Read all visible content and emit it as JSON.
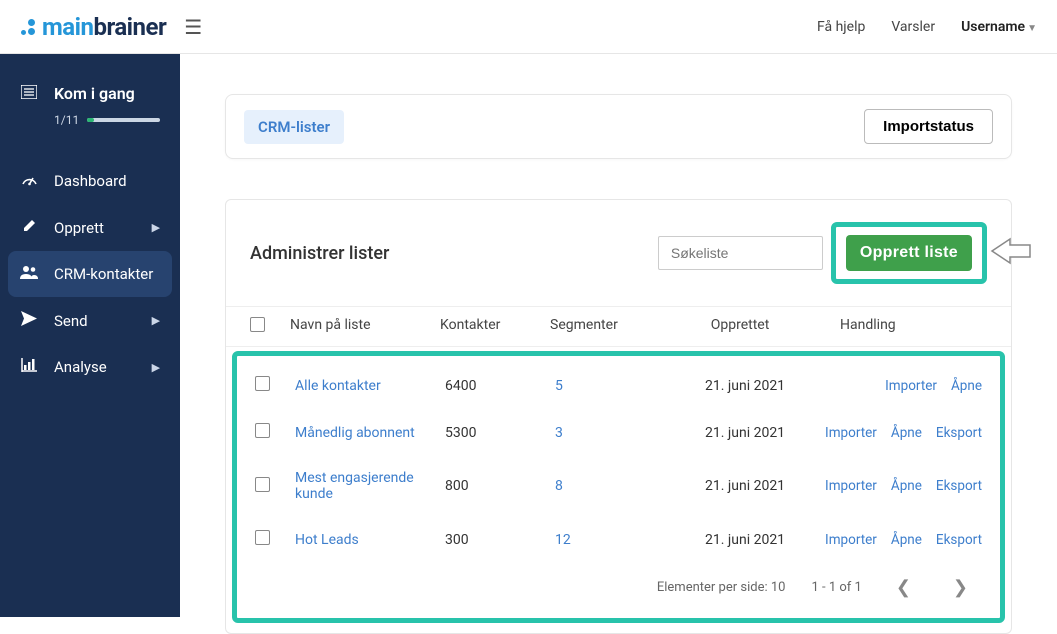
{
  "header": {
    "logo_main": "main",
    "logo_brain": "brainer",
    "help": "Få hjelp",
    "alerts": "Varsler",
    "username": "Username"
  },
  "sidebar": {
    "kom": {
      "title": "Kom i gang",
      "count": "1/11",
      "progress_pct": 9
    },
    "items": [
      {
        "icon": "gauge",
        "label": "Dashboard",
        "has_chevron": false
      },
      {
        "icon": "pencil",
        "label": "Opprett",
        "has_chevron": true
      },
      {
        "icon": "users",
        "label": "CRM-kontakter",
        "has_chevron": false,
        "active": true
      },
      {
        "icon": "paperplane",
        "label": "Send",
        "has_chevron": true
      },
      {
        "icon": "chart",
        "label": "Analyse",
        "has_chevron": true
      }
    ]
  },
  "top_card": {
    "crm_pill": "CRM-lister",
    "import_status": "Importstatus"
  },
  "table": {
    "title": "Administrer lister",
    "search_placeholder": "Søkeliste",
    "create_btn": "Opprett liste",
    "columns": {
      "name": "Navn på liste",
      "contacts": "Kontakter",
      "segments": "Segmenter",
      "created": "Opprettet",
      "action": "Handling"
    },
    "rows": [
      {
        "name": "Alle kontakter",
        "contacts": "6400",
        "segments": "5",
        "created": "21. juni 2021",
        "actions": [
          "Importer",
          "Åpne"
        ]
      },
      {
        "name": "Månedlig abonnent",
        "contacts": "5300",
        "segments": "3",
        "created": "21. juni 2021",
        "actions": [
          "Importer",
          "Åpne",
          "Eksport"
        ]
      },
      {
        "name": "Mest engasjerende kunde",
        "contacts": "800",
        "segments": "8",
        "created": "21. juni 2021",
        "actions": [
          "Importer",
          "Åpne",
          "Eksport"
        ]
      },
      {
        "name": "Hot Leads",
        "contacts": "300",
        "segments": "12",
        "created": "21. juni 2021",
        "actions": [
          "Importer",
          "Åpne",
          "Eksport"
        ]
      }
    ],
    "pager": {
      "per_page_label": "Elementer per side: 10",
      "range": "1 - 1 of 1"
    }
  }
}
